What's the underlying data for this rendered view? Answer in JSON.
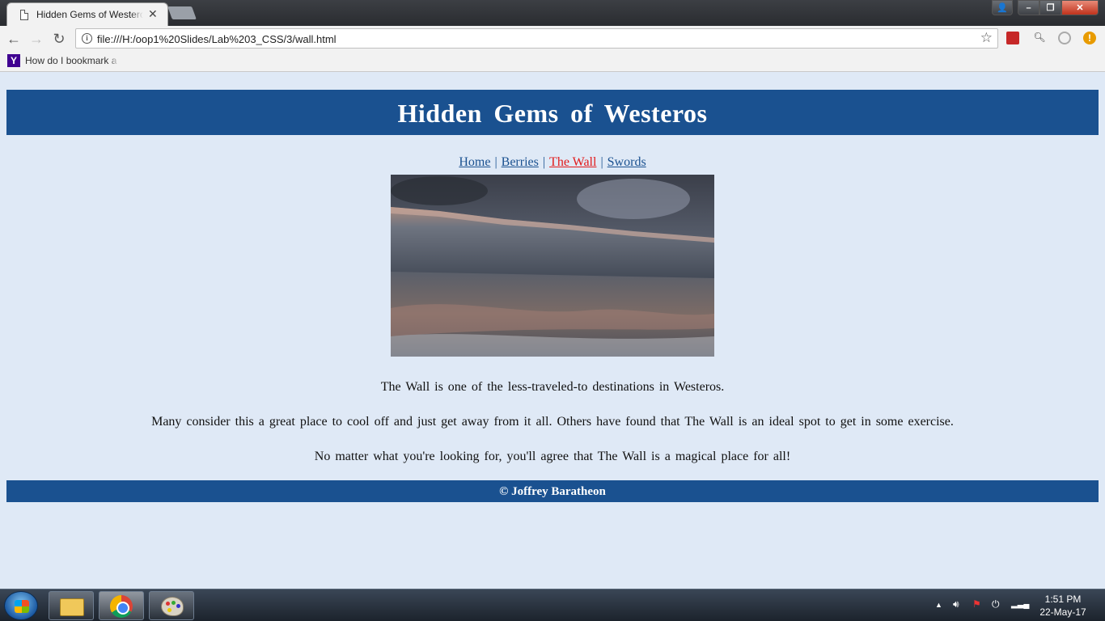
{
  "browser": {
    "tab_title": "Hidden Gems of Westeros",
    "url": "file:///H:/oop1%20Slides/Lab%203_CSS/3/wall.html",
    "bookmark_label": "How do I bookmark a",
    "bookmark_icon_letter": "Y"
  },
  "page": {
    "header_title": "Hidden Gems of Westeros",
    "nav": [
      {
        "label": "Home",
        "active": false
      },
      {
        "label": "Berries",
        "active": false
      },
      {
        "label": "The Wall",
        "active": true
      },
      {
        "label": "Swords",
        "active": false
      }
    ],
    "paragraphs": [
      "The Wall is one of the less-traveled-to destinations in Westeros.",
      "Many consider this a great place to cool off and just get away from it all. Others have found that The Wall is an ideal spot to get in some exercise.",
      "No matter what you're looking for, you'll agree that The Wall is a magical place for all!"
    ],
    "footer": "© Joffrey Baratheon"
  },
  "taskbar": {
    "time": "1:51 PM",
    "date": "22-May-17"
  },
  "colors": {
    "page_background": "#dfe9f6",
    "header_background": "#1a5190",
    "link": "#1a5190",
    "active_link": "#e21a1a"
  }
}
